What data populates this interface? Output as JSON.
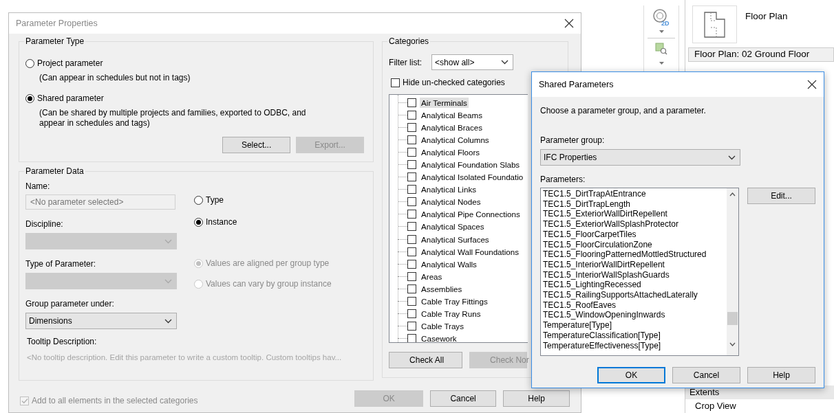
{
  "parameter_properties": {
    "title": "Parameter Properties",
    "parameter_type": {
      "legend": "Parameter Type",
      "options": [
        {
          "label": "Project parameter",
          "description": "(Can appear in schedules but not in tags)",
          "selected": false
        },
        {
          "label": "Shared parameter",
          "description": "(Can be shared by multiple projects and families, exported to ODBC, and appear in schedules and tags)",
          "selected": true
        }
      ],
      "buttons": [
        {
          "label": "Select...",
          "disabled": false
        },
        {
          "label": "Export...",
          "disabled": true
        }
      ]
    },
    "parameter_data": {
      "legend": "Parameter Data",
      "name": {
        "label": "Name:",
        "placeholder": "<No parameter selected>"
      },
      "instance_options": [
        {
          "label": "Type",
          "selected": false
        },
        {
          "label": "Instance",
          "selected": true
        }
      ],
      "discipline": {
        "label": "Discipline:",
        "disabled": true
      },
      "type_of_parameter": {
        "label": "Type of Parameter:",
        "disabled": true
      },
      "group_options": [
        {
          "label": "Values are aligned per group type",
          "selected": true,
          "disabled": true
        },
        {
          "label": "Values can vary by group instance",
          "selected": false,
          "disabled": true
        }
      ],
      "group_under": {
        "label": "Group parameter under:",
        "value": "Dimensions",
        "disabled": false
      },
      "tooltip": {
        "label": "Tooltip Description:",
        "text": "<No tooltip description. Edit this parameter to write a custom tooltip. Custom tooltips hav..."
      }
    },
    "add_to_all": {
      "label": "Add to all elements in the selected categories",
      "checked": true,
      "disabled": true
    },
    "categories": {
      "legend": "Categories",
      "filter_label": "Filter list:",
      "filter_value": "<show all>",
      "hide_unchecked": {
        "label": "Hide un-checked categories",
        "checked": false
      },
      "items": [
        {
          "label": "Air Terminals",
          "checked": false,
          "selected": true
        },
        {
          "label": "Analytical Beams",
          "checked": false,
          "selected": false
        },
        {
          "label": "Analytical Braces",
          "checked": false,
          "selected": false
        },
        {
          "label": "Analytical Columns",
          "checked": false,
          "selected": false
        },
        {
          "label": "Analytical Floors",
          "checked": false,
          "selected": false
        },
        {
          "label": "Analytical Foundation Slabs",
          "checked": false,
          "selected": false
        },
        {
          "label": "Analytical Isolated Foundatio",
          "checked": false,
          "selected": false
        },
        {
          "label": "Analytical Links",
          "checked": false,
          "selected": false
        },
        {
          "label": "Analytical Nodes",
          "checked": false,
          "selected": false
        },
        {
          "label": "Analytical Pipe Connections",
          "checked": false,
          "selected": false
        },
        {
          "label": "Analytical Spaces",
          "checked": false,
          "selected": false
        },
        {
          "label": "Analytical Surfaces",
          "checked": false,
          "selected": false
        },
        {
          "label": "Analytical Wall Foundations",
          "checked": false,
          "selected": false
        },
        {
          "label": "Analytical Walls",
          "checked": false,
          "selected": false
        },
        {
          "label": "Areas",
          "checked": false,
          "selected": false
        },
        {
          "label": "Assemblies",
          "checked": false,
          "selected": false
        },
        {
          "label": "Cable Tray Fittings",
          "checked": false,
          "selected": false
        },
        {
          "label": "Cable Tray Runs",
          "checked": false,
          "selected": false
        },
        {
          "label": "Cable Trays",
          "checked": false,
          "selected": false
        },
        {
          "label": "Casework",
          "checked": false,
          "selected": false
        }
      ],
      "buttons": [
        {
          "label": "Check All",
          "disabled": false
        },
        {
          "label": "Check Nor",
          "disabled": true
        }
      ]
    },
    "buttons": [
      {
        "label": "OK",
        "disabled": true
      },
      {
        "label": "Cancel",
        "disabled": false
      },
      {
        "label": "Help",
        "disabled": false
      }
    ]
  },
  "shared_parameters": {
    "title": "Shared Parameters",
    "prompt": "Choose a parameter group, and a parameter.",
    "group_label": "Parameter group:",
    "group_value": "IFC Properties",
    "parameters_label": "Parameters:",
    "parameters": [
      "TEC1.5_DirtTrapAtEntrance",
      "TEC1.5_DirtTrapLength",
      "TEC1.5_ExteriorWallDirtRepellent",
      "TEC1.5_ExteriorWallSplashProtector",
      "TEC1.5_FloorCarpetTiles",
      "TEC1.5_FloorCirculationZone",
      "TEC1.5_FlooringPatternedMottledStructured",
      "TEC1.5_InteriorWallDirtRepellent",
      "TEC1.5_InteriorWallSplashGuards",
      "TEC1.5_LightingRecessed",
      "TEC1.5_RailingSupportsAttachedLaterally",
      "TEC1.5_RoofEaves",
      "TEC1.5_WindowOpeningInwards",
      "Temperature[Type]",
      "TemperatureClassification[Type]",
      "TemperatureEffectiveness[Type]"
    ],
    "edit_button": "Edit...",
    "buttons": [
      {
        "label": "OK",
        "default": true
      },
      {
        "label": "Cancel",
        "default": false
      },
      {
        "label": "Help",
        "default": false
      }
    ]
  },
  "properties_panel": {
    "view_icon_badge": "2D",
    "type_name": "Floor Plan",
    "view_selector": "Floor Plan: 02 Ground Floor",
    "rows": [
      {
        "label": "Extents",
        "kind": "header"
      },
      {
        "label": "Crop View",
        "kind": "row"
      }
    ]
  }
}
